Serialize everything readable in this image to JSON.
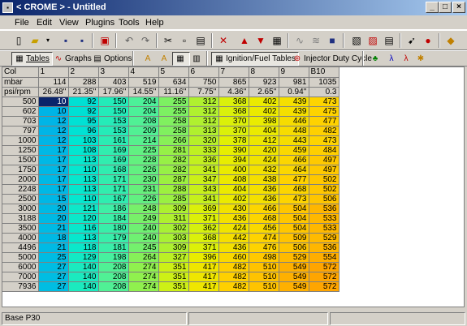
{
  "window": {
    "title": "< CROME > - Untitled",
    "minimize": "_",
    "maximize": "□",
    "close": "×"
  },
  "menu": [
    "File",
    "Edit",
    "View",
    "Plugins",
    "Tools",
    "Help"
  ],
  "toolbar2": {
    "tables": "Tables",
    "graphs": "Graphs",
    "options": "Options",
    "ignfuel": "Ignition/Fuel Tables",
    "injector": "Injector Duty Cycle"
  },
  "grid": {
    "corner": "Col",
    "mbar_label": "mbar",
    "psi_label": "psi/rpm",
    "cols": [
      "1",
      "2",
      "3",
      "4",
      "5",
      "6",
      "7",
      "8",
      "9",
      "B10"
    ],
    "mbar": [
      "114",
      "288",
      "403",
      "519",
      "634",
      "750",
      "865",
      "923",
      "981",
      "1035"
    ],
    "psi": [
      "26.48''",
      "21.35''",
      "17.96''",
      "14.55''",
      "11.16''",
      "7.75''",
      "4.36''",
      "2.65''",
      "0.94''",
      "0.3"
    ],
    "rows": [
      {
        "rpm": "500",
        "v": [
          "10",
          "92",
          "150",
          "204",
          "255",
          "312",
          "368",
          "402",
          "439",
          "473"
        ]
      },
      {
        "rpm": "602",
        "v": [
          "10",
          "92",
          "150",
          "204",
          "255",
          "312",
          "368",
          "402",
          "439",
          "475"
        ]
      },
      {
        "rpm": "703",
        "v": [
          "12",
          "95",
          "153",
          "208",
          "258",
          "312",
          "370",
          "398",
          "446",
          "477"
        ]
      },
      {
        "rpm": "797",
        "v": [
          "12",
          "96",
          "153",
          "209",
          "258",
          "313",
          "370",
          "404",
          "448",
          "482"
        ]
      },
      {
        "rpm": "1000",
        "v": [
          "12",
          "103",
          "161",
          "214",
          "266",
          "320",
          "378",
          "412",
          "443",
          "473"
        ]
      },
      {
        "rpm": "1250",
        "v": [
          "17",
          "108",
          "169",
          "225",
          "281",
          "333",
          "390",
          "420",
          "459",
          "484"
        ]
      },
      {
        "rpm": "1500",
        "v": [
          "17",
          "113",
          "169",
          "228",
          "282",
          "336",
          "394",
          "424",
          "466",
          "497"
        ]
      },
      {
        "rpm": "1750",
        "v": [
          "17",
          "110",
          "168",
          "226",
          "282",
          "341",
          "400",
          "432",
          "464",
          "497"
        ]
      },
      {
        "rpm": "2000",
        "v": [
          "17",
          "113",
          "171",
          "230",
          "287",
          "347",
          "408",
          "438",
          "477",
          "502"
        ]
      },
      {
        "rpm": "2248",
        "v": [
          "17",
          "113",
          "171",
          "231",
          "288",
          "343",
          "404",
          "436",
          "468",
          "502"
        ]
      },
      {
        "rpm": "2500",
        "v": [
          "15",
          "110",
          "167",
          "226",
          "285",
          "341",
          "402",
          "436",
          "473",
          "506"
        ]
      },
      {
        "rpm": "3000",
        "v": [
          "20",
          "121",
          "186",
          "248",
          "309",
          "369",
          "430",
          "466",
          "504",
          "536"
        ]
      },
      {
        "rpm": "3188",
        "v": [
          "20",
          "120",
          "184",
          "249",
          "311",
          "371",
          "436",
          "468",
          "504",
          "533"
        ]
      },
      {
        "rpm": "3500",
        "v": [
          "21",
          "116",
          "180",
          "240",
          "302",
          "362",
          "424",
          "456",
          "504",
          "533"
        ]
      },
      {
        "rpm": "4000",
        "v": [
          "18",
          "113",
          "179",
          "240",
          "303",
          "368",
          "442",
          "474",
          "509",
          "529"
        ]
      },
      {
        "rpm": "4496",
        "v": [
          "21",
          "118",
          "181",
          "245",
          "309",
          "371",
          "436",
          "476",
          "506",
          "536"
        ]
      },
      {
        "rpm": "5000",
        "v": [
          "25",
          "129",
          "198",
          "264",
          "327",
          "396",
          "460",
          "498",
          "529",
          "554"
        ]
      },
      {
        "rpm": "6000",
        "v": [
          "27",
          "140",
          "208",
          "274",
          "351",
          "417",
          "482",
          "510",
          "549",
          "572"
        ]
      },
      {
        "rpm": "7000",
        "v": [
          "27",
          "140",
          "208",
          "274",
          "351",
          "417",
          "482",
          "510",
          "549",
          "572"
        ]
      },
      {
        "rpm": "7936",
        "v": [
          "27",
          "140",
          "208",
          "274",
          "351",
          "417",
          "482",
          "510",
          "549",
          "572"
        ]
      }
    ]
  },
  "status": {
    "left": "Base P30"
  },
  "colors": {
    "stops": [
      "#00b4e6",
      "#00e6d2",
      "#46f0a0",
      "#a0f03c",
      "#e6f000",
      "#ffd200",
      "#ffa500"
    ],
    "selected": "#0a246a",
    "title": "#0a246a"
  }
}
